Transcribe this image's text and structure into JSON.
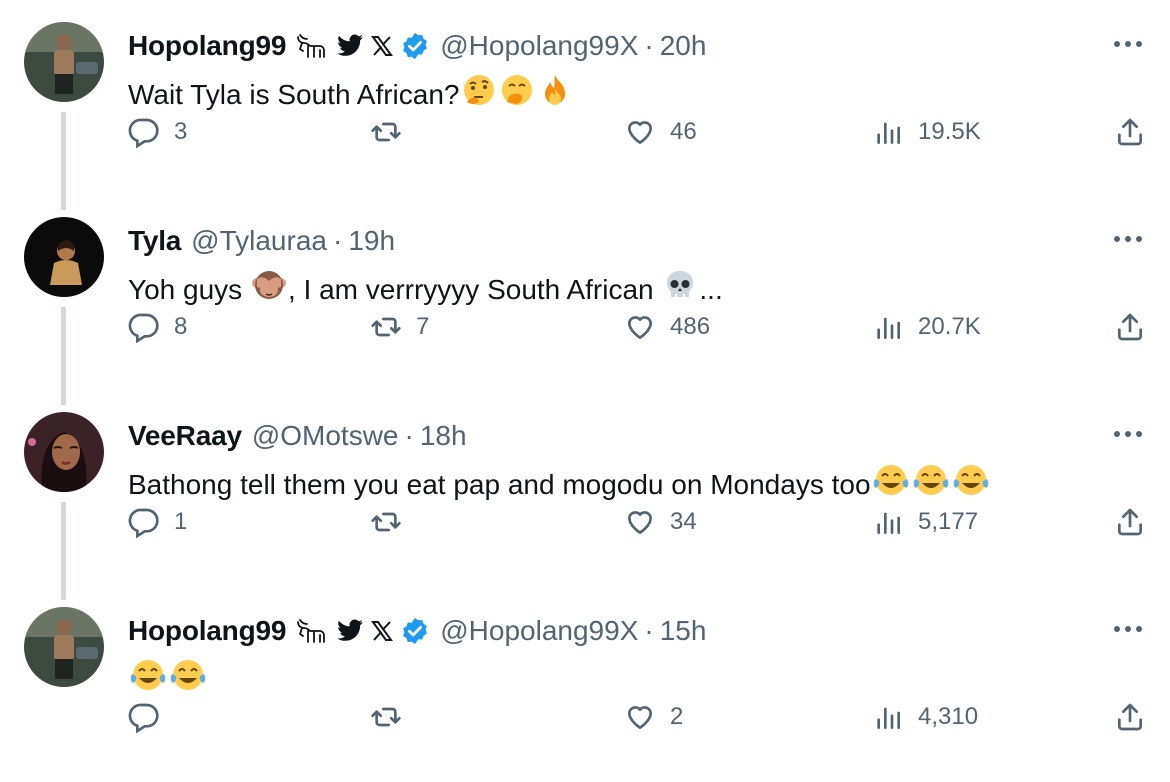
{
  "tweets": [
    {
      "name": "Hopolang99",
      "handle": "@Hopolang99X",
      "dot": "·",
      "time": "20h",
      "text": "Wait Tyla is South African?",
      "emojis": [
        "thinking-face",
        "hand-over-mouth-face",
        "fire"
      ],
      "badges": [
        "goat-icon",
        "bird-icon",
        "x-logo-icon",
        "verified-icon"
      ],
      "replies": "3",
      "retweets": "",
      "likes": "46",
      "views": "19.5K",
      "avatar": "avatar-hopolang"
    },
    {
      "name": "Tyla",
      "handle": "@Tylauraa",
      "dot": "·",
      "time": "19h",
      "text_before": "Yoh guys ",
      "text_middle": ", I am verrryyyy South African ",
      "text_after": "...",
      "emojis": [
        "see-no-evil-monkey",
        "skull"
      ],
      "replies": "8",
      "retweets": "7",
      "likes": "486",
      "views": "20.7K",
      "avatar": "avatar-tyla"
    },
    {
      "name": "VeeRaay",
      "handle": "@OMotswe",
      "dot": "·",
      "time": "18h",
      "text": "Bathong tell them you eat pap and mogodu on Mondays too",
      "emojis": [
        "tears-of-joy",
        "tears-of-joy",
        "tears-of-joy"
      ],
      "replies": "1",
      "retweets": "",
      "likes": "34",
      "views": "5,177",
      "avatar": "avatar-veeraay"
    },
    {
      "name": "Hopolang99",
      "handle": "@Hopolang99X",
      "dot": "·",
      "time": "15h",
      "text": "",
      "emojis": [
        "tears-of-joy",
        "tears-of-joy"
      ],
      "badges": [
        "goat-icon",
        "bird-icon",
        "x-logo-icon",
        "verified-icon"
      ],
      "replies": "",
      "retweets": "",
      "likes": "2",
      "views": "4,310",
      "avatar": "avatar-hopolang"
    }
  ],
  "colors": {
    "text": "#0f1419",
    "secondary": "#536471",
    "verified": "#1d9bf0",
    "thread_line": "#cfd9de",
    "emoji_yellow": "#ffcc4d"
  }
}
